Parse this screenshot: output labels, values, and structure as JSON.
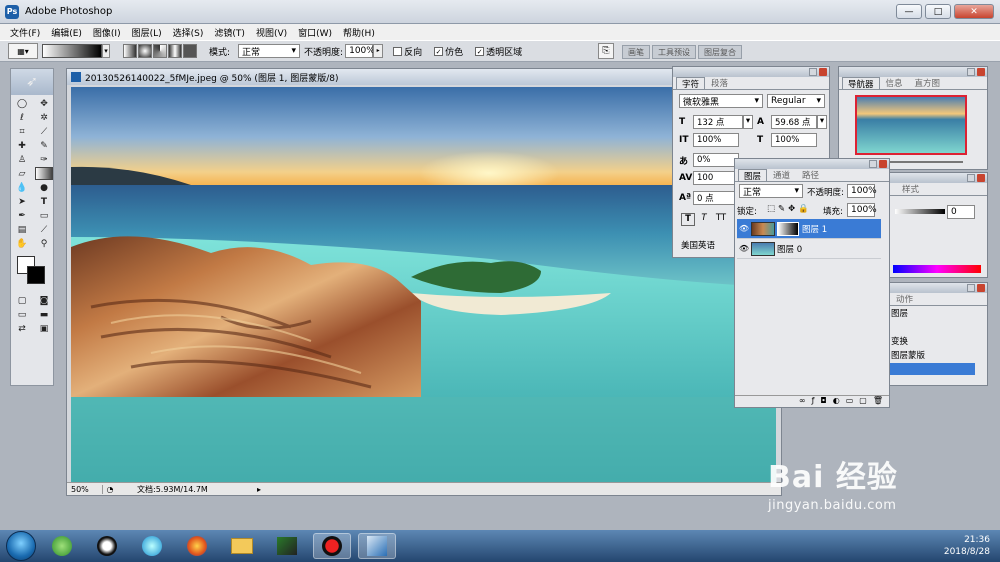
{
  "app": {
    "title": "Adobe Photoshop"
  },
  "window_controls": {
    "minimize": "—",
    "restore": "□",
    "close": "✕"
  },
  "menu": [
    "文件(F)",
    "编辑(E)",
    "图像(I)",
    "图层(L)",
    "选择(S)",
    "滤镜(T)",
    "视图(V)",
    "窗口(W)",
    "帮助(H)"
  ],
  "options_bar": {
    "mode_label": "模式:",
    "mode_value": "正常",
    "opacity_label": "不透明度:",
    "opacity_value": "100%",
    "reverse_label": "反向",
    "dither_label": "仿色",
    "transparency_label": "透明区域",
    "well_tabs": [
      "画笔",
      "工具预设",
      "图层复合"
    ]
  },
  "document": {
    "title": "20130526140022_5fMJe.jpeg @ 50% (图层 1, 图层蒙版/8)",
    "zoom": "50%",
    "doc_size": "文档:5.93M/14.7M"
  },
  "character_panel": {
    "tabs": [
      "字符",
      "段落"
    ],
    "font_family": "微软雅黑",
    "font_style": "Regular",
    "font_size": "132 点",
    "leading": "59.68 点",
    "vertical_scale": "100%",
    "horizontal_scale": "100%",
    "tsume": "0%",
    "tracking": "100",
    "baseline_shift": "0 点",
    "language": "美国英语",
    "style_buttons": [
      "T",
      "T",
      "TT"
    ]
  },
  "layers_panel": {
    "tabs": [
      "图层",
      "通道",
      "路径"
    ],
    "blend_mode": "正常",
    "opacity_label": "不透明度:",
    "opacity_value": "100%",
    "lock_label": "锁定:",
    "fill_label": "填充:",
    "fill_value": "100%",
    "layers": [
      {
        "name": "图层 1",
        "selected": true
      },
      {
        "name": "图层 0",
        "selected": false
      }
    ]
  },
  "navigator_panel": {
    "tabs": [
      "导航器",
      "信息",
      "直方图"
    ]
  },
  "color_panel": {
    "tab": "样式",
    "value": "0"
  },
  "history_panel": {
    "tab": "动作",
    "items": [
      "图层",
      "变换",
      "图层蒙版"
    ]
  },
  "taskbar": {
    "time": "21:36",
    "date": "2018/8/28"
  },
  "watermark": {
    "logo": "Bai 经验",
    "url": "jingyan.baidu.com"
  },
  "colors": {
    "selection": "#3a7bd5",
    "taskbar": "#24466f"
  }
}
